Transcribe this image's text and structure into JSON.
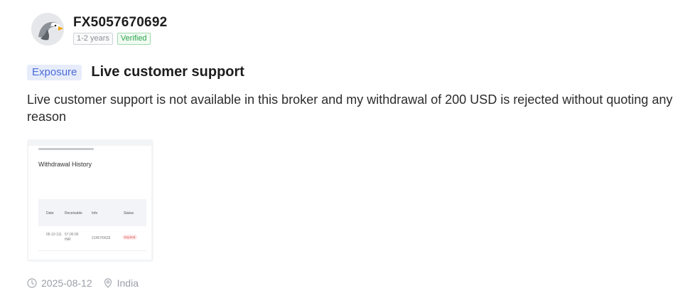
{
  "user": {
    "name": "FX5057670692",
    "tenure_badge": "1-2 years",
    "verified_badge": "Verified",
    "avatar_icon": "eagle-avatar-icon"
  },
  "post": {
    "tag": "Exposure",
    "title": "Live customer support",
    "body": "Live customer support is not available in this broker and my withdrawal of 200 USD is rejected without quoting any reason"
  },
  "attachment": {
    "title": "Withdrawal History",
    "columns": [
      "Date",
      "Receivable",
      "Info",
      "Status"
    ],
    "row": {
      "date": "05-10 111",
      "receivable": "57.00 00 INR",
      "info": "21457/0633",
      "status": "Expired"
    }
  },
  "footer": {
    "date": "2025-08-12",
    "location": "India",
    "clock_icon": "clock-icon",
    "location_icon": "location-pin-icon"
  },
  "colors": {
    "tag_bg": "#e7ecfb",
    "tag_text": "#4a6bd8",
    "verified": "#2ca44a",
    "muted": "#9a9ea6"
  }
}
